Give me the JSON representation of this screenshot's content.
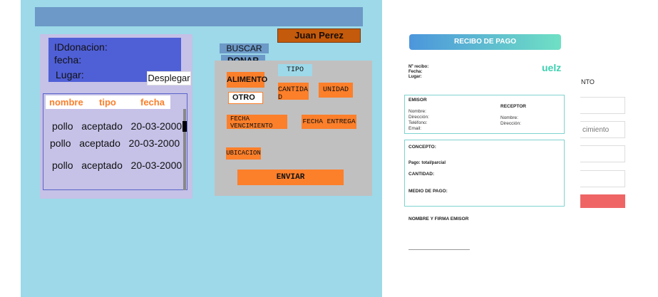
{
  "colors": {
    "canvas_bg": "#9dd9e9",
    "top_bar": "#6c99c7",
    "user_badge": "#c45a0b",
    "info_panel": "#c5c1e7",
    "info_header": "#4f5fd6",
    "orange": "#fc7f2a",
    "form_panel": "#c0c0c0",
    "receipt_accent": "#69c6d8",
    "receipt_brand": "#3cd1b0",
    "red_button": "#ef6566"
  },
  "user": {
    "name": "Juan Perez"
  },
  "info": {
    "id_label": "IDdonacion:",
    "date_label": "fecha:",
    "place_label": "Lugar:",
    "expand_button": "Desplegar"
  },
  "table": {
    "headers": [
      "nombre",
      "tipo",
      "fecha"
    ],
    "rows": [
      [
        "pollo",
        "aceptado",
        "20-03-2000"
      ],
      [
        "pollo",
        "aceptado",
        "20-03-2000"
      ],
      [
        "pollo",
        "aceptado",
        "20-03-2000"
      ]
    ]
  },
  "actions": {
    "search": "BUSCAR",
    "donate": "DONAR"
  },
  "form": {
    "food_button": "ALIMENTO",
    "other_button": "OTRO",
    "type_label": "TIPO",
    "quantity_label": "CANTIDAD",
    "unit_label": "UNIDAD",
    "expiry_label": "FECHA VENCIMIENTO",
    "delivery_label": "FECHA ENTREGA",
    "location_label": "UBICACION",
    "send_button": "ENVIAR"
  },
  "receipt": {
    "title": "RECIBO DE PAGO",
    "brand": "uelz",
    "meta": [
      "Nº recibo:",
      "Fecha:",
      "Lugar:"
    ],
    "emisor_title": "EMISOR",
    "emisor_fields": [
      "Nombre:",
      "Dirección:",
      "Teléfono:",
      "Email:"
    ],
    "receptor_title": "RECEPTOR",
    "receptor_fields": [
      "Nombre:",
      "Dirección:"
    ],
    "concepto": "CONCEPTO:",
    "pago": "Pago: total/parcial",
    "cantidad": "CANTIDAD:",
    "medio": "MEDIO DE PAGO:",
    "firma": "NOMBRE Y FIRMA EMISOR"
  },
  "background_form": {
    "label_fragment": "NTO",
    "input_fragment": "cimiento"
  }
}
